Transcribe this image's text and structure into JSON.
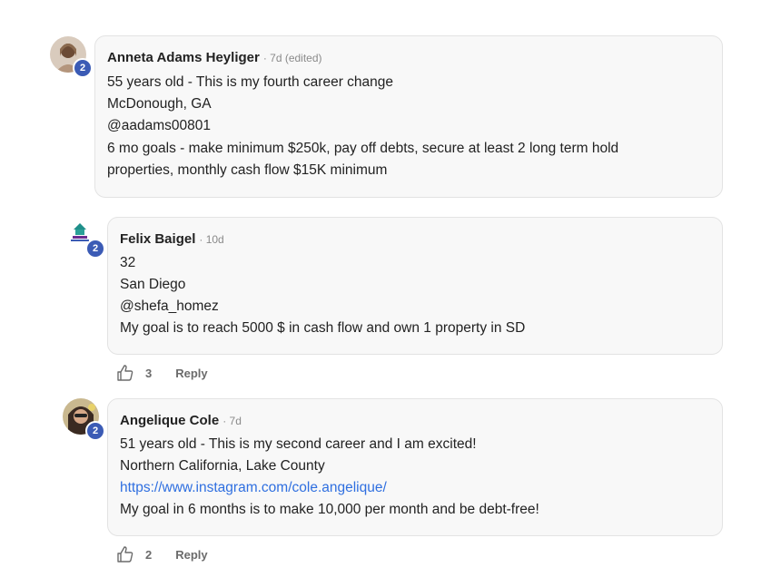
{
  "comments": [
    {
      "author": "Anneta Adams Heyliger",
      "meta": "· 7d (edited)",
      "badge": "2",
      "lines": [
        "55 years old - This is my fourth career change",
        "McDonough, GA",
        "@aadams00801",
        "6 mo goals - make minimum $250k, pay off debts, secure at least 2 long term hold",
        "properties, monthly cash flow $15K minimum"
      ]
    },
    {
      "author": "Felix Baigel",
      "meta": "· 10d",
      "badge": "2",
      "lines": [
        "32",
        "San Diego",
        "@shefa_homez",
        "My goal is to reach 5000 $ in cash flow and own 1 property in SD"
      ],
      "likes": "3",
      "reply_label": "Reply"
    },
    {
      "author": "Angelique Cole",
      "meta": "· 7d",
      "badge": "2",
      "lines": [
        "51 years old - This is my second career and I am excited!",
        "Northern California, Lake County",
        "https://www.instagram.com/cole.angelique/",
        "My goal in 6 months is to make 10,000 per month and be debt-free!"
      ],
      "likes": "2",
      "reply_label": "Reply"
    }
  ],
  "colors": {
    "link": "#2f6fe0",
    "badge": "#3b5bb5",
    "bubble": "#f8f8f8"
  },
  "icons": {
    "like": "thumbs-up-icon"
  }
}
